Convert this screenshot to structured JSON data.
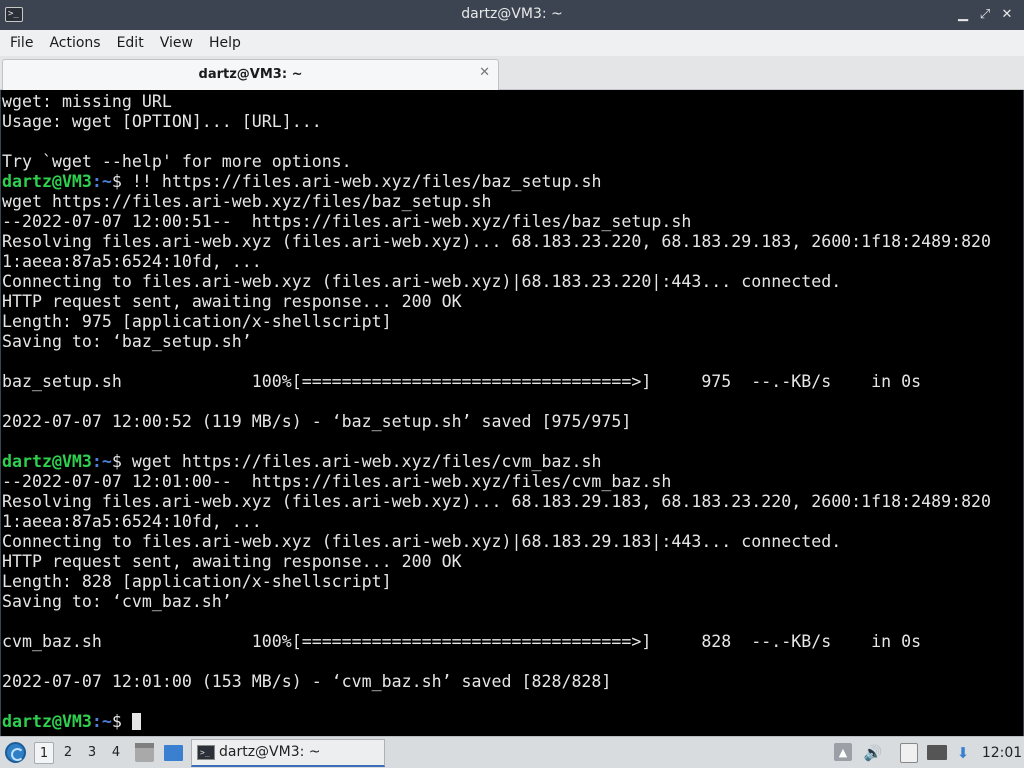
{
  "window": {
    "title": "dartz@VM3: ~",
    "buttons": {
      "minimize": "▁",
      "restore": "⤢",
      "close": "✕"
    }
  },
  "menu": [
    "File",
    "Actions",
    "Edit",
    "View",
    "Help"
  ],
  "tab": {
    "label": "dartz@VM3: ~",
    "close": "✕"
  },
  "terminal": {
    "prompt_user": "dartz@VM3",
    "prompt_path": ":~",
    "prompt_sym": "$ ",
    "lines": [
      {
        "text": "wget: missing URL"
      },
      {
        "text": "Usage: wget [OPTION]... [URL]..."
      },
      {
        "text": ""
      },
      {
        "text": "Try `wget --help' for more options."
      },
      {
        "cmd": "!! https://files.ari-web.xyz/files/baz_setup.sh"
      },
      {
        "text": "wget https://files.ari-web.xyz/files/baz_setup.sh"
      },
      {
        "text": "--2022-07-07 12:00:51--  https://files.ari-web.xyz/files/baz_setup.sh"
      },
      {
        "text": "Resolving files.ari-web.xyz (files.ari-web.xyz)... 68.183.23.220, 68.183.29.183, 2600:1f18:2489:820"
      },
      {
        "text": "1:aeea:87a5:6524:10fd, ..."
      },
      {
        "text": "Connecting to files.ari-web.xyz (files.ari-web.xyz)|68.183.23.220|:443... connected."
      },
      {
        "text": "HTTP request sent, awaiting response... 200 OK"
      },
      {
        "text": "Length: 975 [application/x-shellscript]"
      },
      {
        "text": "Saving to: ‘baz_setup.sh’"
      },
      {
        "text": ""
      },
      {
        "text": "baz_setup.sh             100%[=================================>]     975  --.-KB/s    in 0s"
      },
      {
        "text": ""
      },
      {
        "text": "2022-07-07 12:00:52 (119 MB/s) - ‘baz_setup.sh’ saved [975/975]"
      },
      {
        "text": ""
      },
      {
        "cmd": "wget https://files.ari-web.xyz/files/cvm_baz.sh"
      },
      {
        "text": "--2022-07-07 12:01:00--  https://files.ari-web.xyz/files/cvm_baz.sh"
      },
      {
        "text": "Resolving files.ari-web.xyz (files.ari-web.xyz)... 68.183.29.183, 68.183.23.220, 2600:1f18:2489:820"
      },
      {
        "text": "1:aeea:87a5:6524:10fd, ..."
      },
      {
        "text": "Connecting to files.ari-web.xyz (files.ari-web.xyz)|68.183.29.183|:443... connected."
      },
      {
        "text": "HTTP request sent, awaiting response... 200 OK"
      },
      {
        "text": "Length: 828 [application/x-shellscript]"
      },
      {
        "text": "Saving to: ‘cvm_baz.sh’"
      },
      {
        "text": ""
      },
      {
        "text": "cvm_baz.sh               100%[=================================>]     828  --.-KB/s    in 0s"
      },
      {
        "text": ""
      },
      {
        "text": "2022-07-07 12:01:00 (153 MB/s) - ‘cvm_baz.sh’ saved [828/828]"
      },
      {
        "text": ""
      },
      {
        "cmd": "",
        "cursor": true
      }
    ]
  },
  "taskbar": {
    "workspaces": [
      "1",
      "2",
      "3",
      "4"
    ],
    "active_workspace": "1",
    "task_label": "dartz@VM3: ~",
    "clock": "12:01",
    "icons": [
      "start-menu-icon",
      "file-manager-icon",
      "show-desktop-icon",
      "keyboard-icon",
      "volume-icon",
      "clipboard-icon",
      "network-icon",
      "update-icon"
    ]
  },
  "colors": {
    "prompt_user": "#2fcf4f",
    "prompt_path": "#4d7ed8",
    "terminal_bg": "#000000",
    "terminal_fg": "#e6e6e6"
  }
}
